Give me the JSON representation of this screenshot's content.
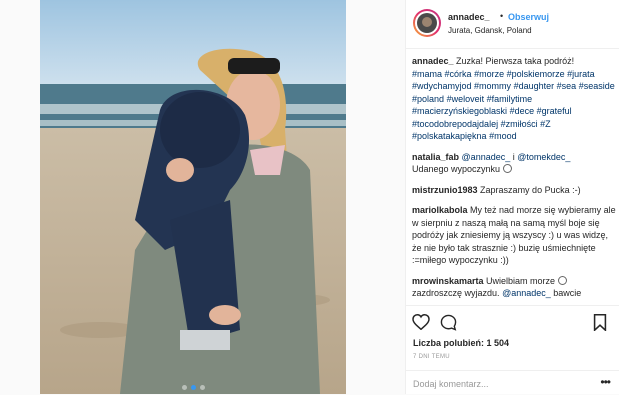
{
  "post": {
    "username": "annadec_",
    "separator": "•",
    "follow_label": "Obserwuj",
    "location": "Jurata, Gdansk, Poland",
    "caption_user": "annadec_",
    "caption_text": "Zuzka! Pierwsza taka podróż!",
    "hashtags": [
      "#mama",
      "#córka",
      "#morze",
      "#polskiemorze",
      "#jurata",
      "#wdychamyjod",
      "#mommy",
      "#daughter",
      "#sea",
      "#seaside",
      "#poland",
      "#weloveit",
      "#familytime",
      "#macierzyńskiegoblaski",
      "#dece",
      "#grateful",
      "#tocodobrepodajdalej",
      "#zmiłości",
      "#Z",
      "#polskatakapiękna",
      "#mood"
    ],
    "comments": [
      {
        "user": "natalia_fab",
        "mention1": "@annadec_",
        "mid": "i",
        "mention2": "@tomekdec_",
        "text": "Udanego wypoczynku"
      },
      {
        "user": "mistrzunio1983",
        "text": "Zapraszamy do Pucka :-)"
      },
      {
        "user": "mariolkabola",
        "text": "My też nad morze się wybieramy ale w sierpniu z naszą małą na samą myśl boje się podróży jak zniesiemy ją wszyscy :) u was widzę, że nie było tak strasznie :) buzię uśmiechnięte :=miłego wypoczynku :))"
      },
      {
        "user": "mrowinskamarta",
        "text": "Uwielbiam morze",
        "text2": "zazdroszczę wyjazdu.",
        "mention": "@annadec_",
        "text3": "bawcie"
      }
    ],
    "likes_label": "Liczba polubień: 1 504",
    "time_label": "7 DNI TEMU",
    "add_comment_placeholder": "Dodaj komentarz...",
    "more_label": "•••",
    "carousel_count": 3,
    "carousel_active": 2
  },
  "colors": {
    "link": "#3897f0",
    "hashtag": "#003569",
    "text": "#262626",
    "muted": "#999999"
  },
  "icons": [
    "heart-icon",
    "comment-icon",
    "bookmark-icon"
  ]
}
